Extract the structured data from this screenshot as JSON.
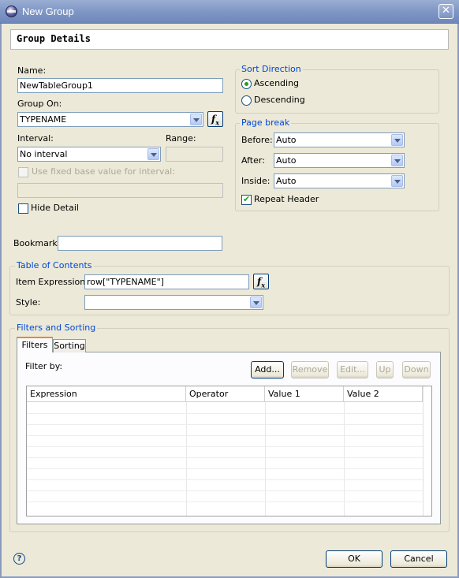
{
  "window": {
    "title": "New Group",
    "close_symbol": "✕"
  },
  "header": {
    "text": "Group Details"
  },
  "left": {
    "name_label": "Name:",
    "name_value": "NewTableGroup1",
    "group_on_label": "Group On:",
    "group_on_value": "TYPENAME",
    "interval_label": "Interval:",
    "interval_value": "No interval",
    "range_label": "Range:",
    "use_fixed_label": "Use fixed base value for interval:",
    "hide_detail_label": "Hide Detail"
  },
  "sort": {
    "title": "Sort Direction",
    "ascending": "Ascending",
    "descending": "Descending",
    "selected": "Ascending"
  },
  "page_break": {
    "title": "Page break",
    "before_label": "Before:",
    "before_value": "Auto",
    "after_label": "After:",
    "after_value": "Auto",
    "inside_label": "Inside:",
    "inside_value": "Auto",
    "repeat_header_label": "Repeat Header",
    "repeat_header_checked": true
  },
  "bookmark": {
    "label": "Bookmark:",
    "value": ""
  },
  "toc": {
    "title": "Table of Contents",
    "item_expression_label": "Item Expression:",
    "item_expression_value": "row[\"TYPENAME\"]",
    "style_label": "Style:",
    "style_value": ""
  },
  "filters_sorting": {
    "title": "Filters and Sorting",
    "tabs": [
      "Filters",
      "Sorting"
    ],
    "active_tab": "Filters",
    "filter_by_label": "Filter by:",
    "buttons": {
      "add": "Add...",
      "remove": "Remove",
      "edit": "Edit...",
      "up": "Up",
      "down": "Down"
    },
    "columns": [
      "Expression",
      "Operator",
      "Value 1",
      "Value 2"
    ],
    "rows": []
  },
  "footer": {
    "help_symbol": "?",
    "ok": "OK",
    "cancel": "Cancel"
  },
  "fx_symbol": "f",
  "colors": {
    "titlebar": "#7f97c4",
    "group_title": "#0046d5",
    "dialog_bg": "#ece9d8"
  }
}
